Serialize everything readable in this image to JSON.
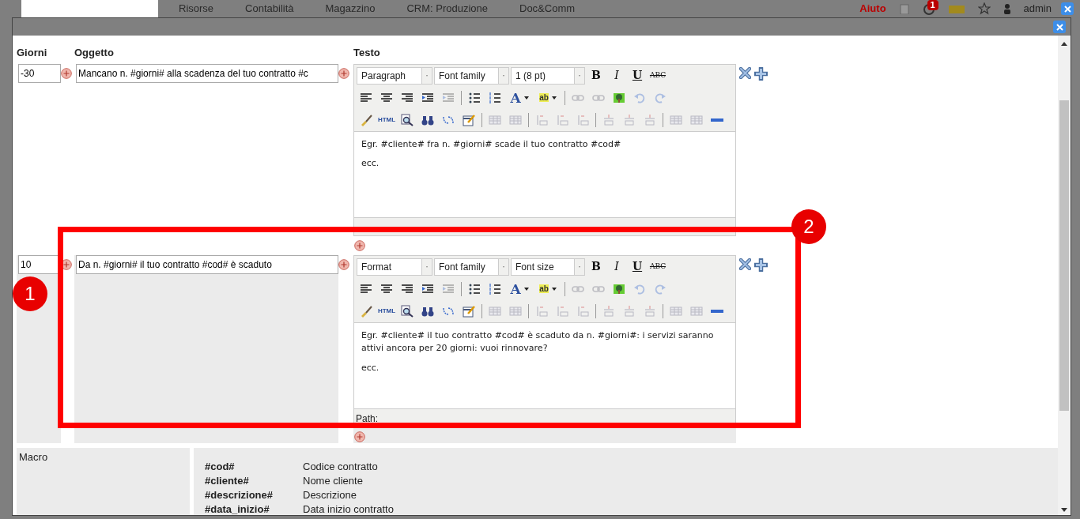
{
  "top_nav": {
    "items": [
      "Risorse",
      "Contabilità",
      "Magazzino",
      "CRM: Produzione",
      "Doc&Comm"
    ],
    "help": "Aiuto",
    "notification_count": "1",
    "user": "admin"
  },
  "table": {
    "columns": [
      "Giorni",
      "Oggetto",
      "Testo"
    ],
    "rows": [
      {
        "giorni": "-30",
        "oggetto": "Mancano n. #giorni# alla scadenza del tuo contratto #c",
        "highlighted": false,
        "editor": {
          "format": "Paragraph",
          "font_family": "Font family",
          "font_size": "1 (8 pt)",
          "buttons": [
            {
              "label": "B",
              "kind": "bold"
            },
            {
              "label": "I",
              "kind": "italic"
            },
            {
              "label": "U",
              "kind": "underline"
            },
            {
              "label": "ABC",
              "kind": "strike"
            }
          ],
          "toolbar": [
            [
              {
                "kind": "align-left",
                "disabled": false
              },
              {
                "kind": "align-center",
                "disabled": false
              },
              {
                "kind": "align-right",
                "disabled": false
              },
              {
                "kind": "indent",
                "disabled": false
              },
              {
                "kind": "outdent",
                "disabled": true
              },
              {
                "kind": "sep"
              },
              {
                "kind": "bullets",
                "disabled": false
              },
              {
                "kind": "numbers",
                "disabled": false
              },
              {
                "kind": "forecolor",
                "label": "A",
                "disabled": false
              },
              {
                "kind": "backcolor",
                "label": "ab",
                "disabled": false
              },
              {
                "kind": "sep"
              },
              {
                "kind": "link",
                "disabled": true
              },
              {
                "kind": "unlink",
                "disabled": true
              },
              {
                "kind": "image",
                "disabled": false
              },
              {
                "kind": "undo",
                "disabled": true
              },
              {
                "kind": "redo",
                "disabled": true
              }
            ],
            [
              {
                "kind": "cleanup",
                "disabled": false
              },
              {
                "kind": "html",
                "label": "HTML",
                "disabled": false
              },
              {
                "kind": "preview",
                "disabled": false
              },
              {
                "kind": "find",
                "disabled": false
              },
              {
                "kind": "replace",
                "disabled": false
              },
              {
                "kind": "edit",
                "disabled": false
              },
              {
                "kind": "sep"
              },
              {
                "kind": "table",
                "disabled": true
              },
              {
                "kind": "table",
                "disabled": true
              },
              {
                "kind": "sep"
              },
              {
                "kind": "column",
                "disabled": true
              },
              {
                "kind": "column",
                "disabled": true
              },
              {
                "kind": "column",
                "disabled": true
              },
              {
                "kind": "sep"
              },
              {
                "kind": "row",
                "disabled": true
              },
              {
                "kind": "row",
                "disabled": true
              },
              {
                "kind": "row",
                "disabled": true
              },
              {
                "kind": "sep"
              },
              {
                "kind": "table",
                "disabled": true
              },
              {
                "kind": "table",
                "disabled": true
              },
              {
                "kind": "hr",
                "disabled": false
              }
            ]
          ],
          "body": [
            "Egr. #cliente# fra n. #giorni# scade il tuo contratto #cod#",
            "ecc."
          ]
        }
      },
      {
        "giorni": "10",
        "oggetto": "Da n. #giorni# il tuo contratto #cod# è scaduto",
        "highlighted": true,
        "editor": {
          "format": "Format",
          "font_family": "Font family",
          "font_size": "Font size",
          "buttons": [
            {
              "label": "B",
              "kind": "bold"
            },
            {
              "label": "I",
              "kind": "italic"
            },
            {
              "label": "U",
              "kind": "underline"
            },
            {
              "label": "ABC",
              "kind": "strike"
            }
          ],
          "toolbar": [
            [
              {
                "kind": "align-left",
                "disabled": false
              },
              {
                "kind": "align-center",
                "disabled": false
              },
              {
                "kind": "align-right",
                "disabled": false
              },
              {
                "kind": "indent",
                "disabled": false
              },
              {
                "kind": "outdent",
                "disabled": true
              },
              {
                "kind": "sep"
              },
              {
                "kind": "bullets",
                "disabled": false
              },
              {
                "kind": "numbers",
                "disabled": false
              },
              {
                "kind": "forecolor",
                "label": "A",
                "disabled": false
              },
              {
                "kind": "backcolor",
                "label": "ab",
                "disabled": false
              },
              {
                "kind": "sep"
              },
              {
                "kind": "link",
                "disabled": true
              },
              {
                "kind": "unlink",
                "disabled": true
              },
              {
                "kind": "image",
                "disabled": false
              },
              {
                "kind": "undo",
                "disabled": true
              },
              {
                "kind": "redo",
                "disabled": true
              }
            ],
            [
              {
                "kind": "cleanup",
                "disabled": false
              },
              {
                "kind": "html",
                "label": "HTML",
                "disabled": false
              },
              {
                "kind": "preview",
                "disabled": false
              },
              {
                "kind": "find",
                "disabled": false
              },
              {
                "kind": "replace",
                "disabled": false
              },
              {
                "kind": "edit",
                "disabled": false
              },
              {
                "kind": "sep"
              },
              {
                "kind": "table",
                "disabled": true
              },
              {
                "kind": "table",
                "disabled": true
              },
              {
                "kind": "sep"
              },
              {
                "kind": "column",
                "disabled": true
              },
              {
                "kind": "column",
                "disabled": true
              },
              {
                "kind": "column",
                "disabled": true
              },
              {
                "kind": "sep"
              },
              {
                "kind": "row",
                "disabled": true
              },
              {
                "kind": "row",
                "disabled": true
              },
              {
                "kind": "row",
                "disabled": true
              },
              {
                "kind": "sep"
              },
              {
                "kind": "table",
                "disabled": true
              },
              {
                "kind": "table",
                "disabled": true
              },
              {
                "kind": "hr",
                "disabled": false
              }
            ]
          ],
          "body": [
            "Egr. #cliente# il tuo contratto #cod# è scaduto da n. #giorni#: i servizi saranno attivi ancora per 20 giorni: vuoi rinnovare?",
            "ecc."
          ],
          "path": "Path:"
        }
      }
    ]
  },
  "macro": {
    "label": "Macro",
    "items": [
      {
        "name": "#cod#",
        "description": "Codice contratto"
      },
      {
        "name": "#cliente#",
        "description": "Nome cliente"
      },
      {
        "name": "#descrizione#",
        "description": "Descrizione"
      },
      {
        "name": "#data_inizio#",
        "description": "Data inizio contratto"
      }
    ]
  },
  "annotations": [
    {
      "label": "1"
    },
    {
      "label": "2"
    }
  ]
}
